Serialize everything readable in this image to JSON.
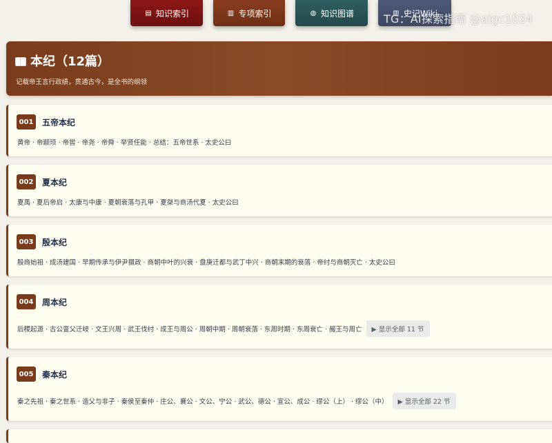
{
  "nav": {
    "buttons": [
      {
        "label": "知识索引",
        "icon": "index-card-icon"
      },
      {
        "label": "专项索引",
        "icon": "book-icon"
      },
      {
        "label": "知识图谱",
        "icon": "globe-icon"
      },
      {
        "label": "史记Wiki",
        "icon": "book-icon"
      }
    ]
  },
  "watermark": "TG：AI探索指南 @aigc1024",
  "header": {
    "title": "本纪（12篇）",
    "description": "记载帝王言行政绩，贯通古今，是全书的纲领"
  },
  "chapters": [
    {
      "number": "001",
      "title": "五帝本纪",
      "sections": "黄帝 · 帝颛顼 · 帝喾 · 帝尧 · 帝舜 · 举贤任能 · 总结：五帝世系 · 太史公曰",
      "show_all": ""
    },
    {
      "number": "002",
      "title": "夏本纪",
      "sections": "夏禹 · 夏后帝启 · 太康与中康 · 夏朝衰落与孔甲 · 夏桀与商汤代夏 · 太史公曰",
      "show_all": ""
    },
    {
      "number": "003",
      "title": "殷本纪",
      "sections": "殷商始祖 · 成汤建国 · 早期传承与伊尹摄政 · 商朝中叶的兴衰 · 盘庚迁都与武丁中兴 · 商朝末期的衰落 · 帝纣与商朝灭亡 · 太史公曰",
      "show_all": ""
    },
    {
      "number": "004",
      "title": "周本纪",
      "sections": "后稷起源 · 古公亶父迁岐 · 文王兴周 · 武王伐纣 · 成王与周公 · 周朝中期 · 周朝衰落 · 东周时期 · 东周衰亡 · 赧王与周亡",
      "show_all": "▶ 显示全部 11 节"
    },
    {
      "number": "005",
      "title": "秦本纪",
      "sections": "秦之先祖 · 秦之世系 · 造父与非子 · 秦侯至秦仲 · 庄公、襄公 · 文公、宁公 · 武公、德公 · 宣公、成公 · 缪公（上） · 缪公（中）",
      "show_all": "▶ 显示全部 22 节"
    }
  ]
}
